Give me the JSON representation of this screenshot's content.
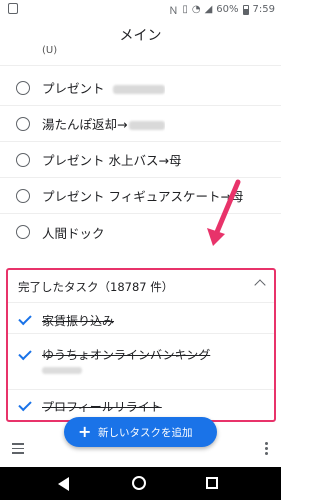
{
  "status_bar": {
    "battery": "60%",
    "time": "7:59"
  },
  "appbar": {
    "title": "メイン"
  },
  "tasks": [
    {
      "label": "(U)",
      "partial": true
    },
    {
      "label": "プレゼント",
      "redacted": true
    },
    {
      "label": "湯たんぽ返却→",
      "redacted": true
    },
    {
      "label": "プレゼント 水上バス→母"
    },
    {
      "label": "プレゼント フィギュアスケート→母"
    },
    {
      "label": "人間ドック"
    }
  ],
  "completed": {
    "header": "完了したタスク（18787 件）",
    "items": [
      {
        "label": "家賃振り込み"
      },
      {
        "label": "ゆうちょオンラインバンキング",
        "has_note": true
      },
      {
        "label": "プロフィールリライト"
      }
    ]
  },
  "fab": {
    "label": "新しいタスクを追加",
    "color": "#1a73e8"
  },
  "colors": {
    "highlight": "#e8336a",
    "accent": "#1a73e8"
  }
}
